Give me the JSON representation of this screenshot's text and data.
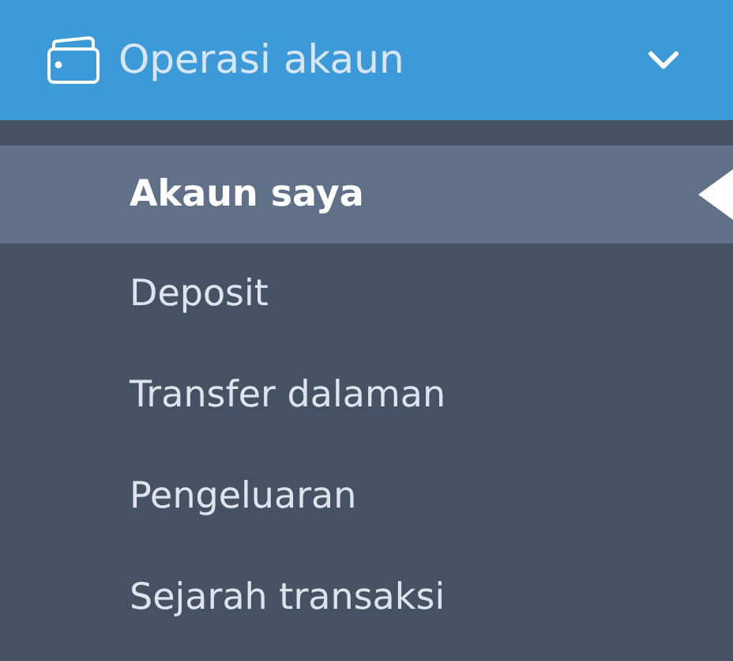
{
  "menu_header": {
    "title": "Operasi akaun",
    "expanded": true
  },
  "items": [
    {
      "label": "Akaun saya",
      "selected": true
    },
    {
      "label": "Deposit",
      "selected": false
    },
    {
      "label": "Transfer dalaman",
      "selected": false
    },
    {
      "label": "Pengeluaran",
      "selected": false
    },
    {
      "label": "Sejarah transaksi",
      "selected": false
    }
  ]
}
